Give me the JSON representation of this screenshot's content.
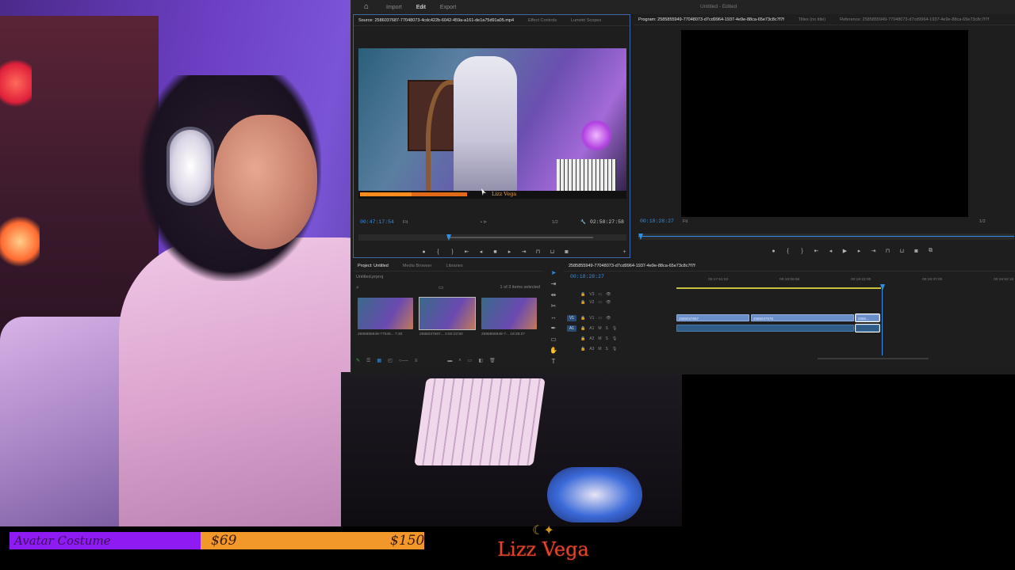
{
  "premiere": {
    "workspaces": [
      "Import",
      "Edit",
      "Export"
    ],
    "active_workspace": "Edit",
    "document_title": "Untitled - Edited",
    "source_panel": {
      "tabs": [
        "Source: 2586037687-77048073-4cdc422b-6042-459a-a161-de1a75d91a05.mp4",
        "Effect Controls",
        "Lumetri Scopes"
      ],
      "timecode_current": "00:47:17:54",
      "fit": "Fit",
      "fraction": "1/2",
      "timecode_duration": "02:50:27:58",
      "lower_third_name": "Lizz Vega"
    },
    "program_panel": {
      "tabs": [
        "Program: 2585855949-77048073-d7cd9964-1937-4e9e-88ca-65e73c8c7f7f",
        "Titles (no title)",
        "Reference: 2585855949-77048073-d7cd9964-1937-4e9e-88ca-65e73c8c7f7f"
      ],
      "timecode_current": "00:18:28:27",
      "fit": "Fit",
      "fraction": "1/2"
    },
    "project_panel": {
      "tabs": [
        "Project: Untitled",
        "Media Browser",
        "Libraries"
      ],
      "file": "Untitled.prproj",
      "selection_count": "1 of 3 items selected",
      "thumbnails": [
        {
          "caption": "2585855949-77048...",
          "duration": "7:40"
        },
        {
          "caption": "2586037687...",
          "duration": "2:50:22:50"
        },
        {
          "caption": "2585855949-7...",
          "duration": "18:28:27"
        }
      ]
    },
    "timeline_panel": {
      "sequence_name": "2585855949-77048073-d7cd9964-1937-4e9e-88ca-65e73c8c7f7f",
      "timecode_current": "00:18:28:27",
      "ruler_ticks": [
        "00:17:51:52",
        "00:18:06:56",
        "00:18:22:00",
        "00:18:37:00",
        "00:18:52:16"
      ],
      "tracks": [
        "V3",
        "V2",
        "V1",
        "A1",
        "A2",
        "A3"
      ],
      "clips": [
        {
          "track": "V1",
          "label": "2586037687"
        },
        {
          "track": "V1",
          "label": "2586037676"
        },
        {
          "track": "V1",
          "label": "2586..."
        }
      ]
    }
  },
  "overlay": {
    "goal_label": "Avatar Costume",
    "goal_current": "$69",
    "goal_target": "$150",
    "goal_progress": 0.46,
    "brand_name": "Lizz Vega"
  },
  "colors": {
    "accent_blue": "#2f8fe8",
    "goal_purple": "#8e1bf2",
    "goal_orange": "#f2972a",
    "brand_red": "#e0462a"
  }
}
